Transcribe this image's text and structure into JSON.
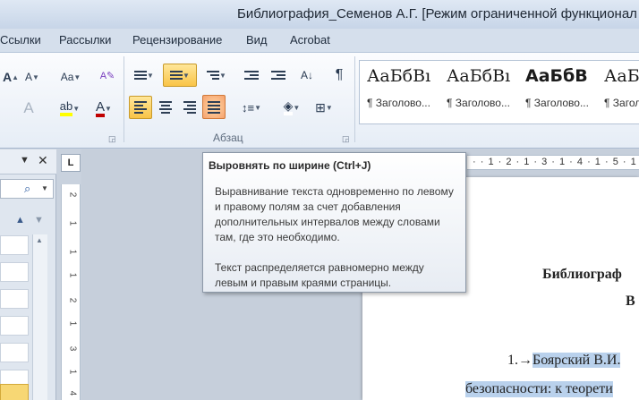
{
  "window": {
    "title": "Библиография_Семенов А.Г. [Режим ограниченной функционал"
  },
  "tabs": [
    "Ссылки",
    "Рассылки",
    "Рецензирование",
    "Вид",
    "Acrobat"
  ],
  "ribbon": {
    "font_group": {
      "font_color": "#c00000",
      "highlight_color": "#ffff00"
    },
    "paragraph": {
      "label": "Абзац",
      "pilcrow": "¶"
    },
    "styles": [
      {
        "sample": "АаБбВı",
        "name": "¶ Заголово..."
      },
      {
        "sample": "АаБбВı",
        "name": "¶ Заголово..."
      },
      {
        "sample": "АаБбВ",
        "name": "¶ Заголово..."
      },
      {
        "sample": "АаБ",
        "name": "¶ Заголово"
      }
    ]
  },
  "ruler": {
    "horizontal": "· · 1 · 2 · 1 · 3 · 1 · 4 · 1 · 5 · 1",
    "vertical": [
      "2",
      "1",
      "1",
      "1",
      "2",
      "1",
      "3",
      "1",
      "4"
    ]
  },
  "tooltip": {
    "title": "Выровнять по ширине (Ctrl+J)",
    "description": "Выравнивание текста одновременно по левому и правому полям за счет добавления дополнительных интервалов между словами там, где это необходимо.",
    "detail": "Текст распределяется равномерно между левым и правым краями страницы."
  },
  "document": {
    "title": "Библиограф",
    "title_line2": "В",
    "item_number": "1.→",
    "item_text": "Боярский В.И.",
    "line2": "безопасности: к теорети"
  }
}
